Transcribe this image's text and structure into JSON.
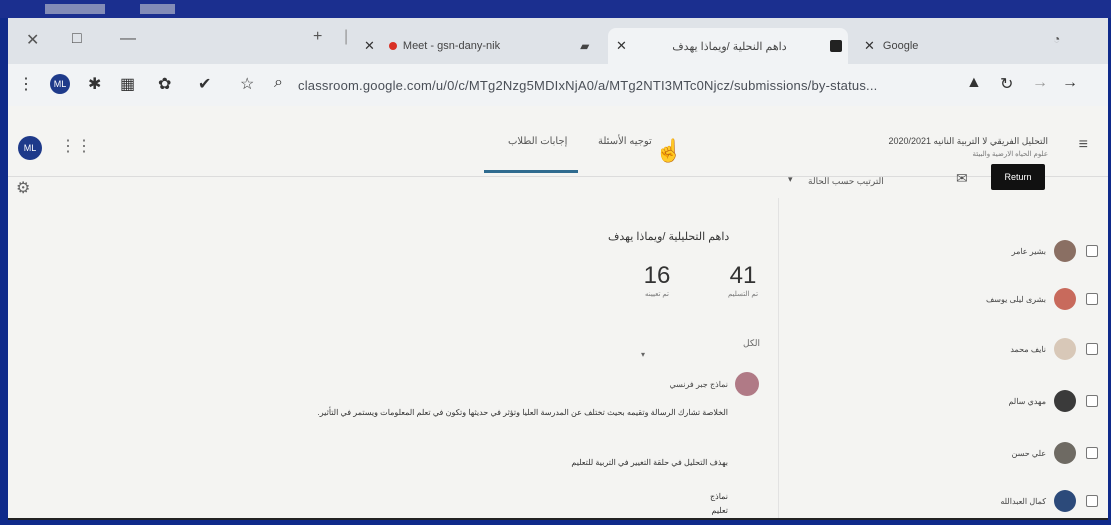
{
  "browser": {
    "tabs": [
      {
        "label": "Meet - gsn-dany-nik"
      },
      {
        "label": "داهم النحلية /ويماذا يهدف"
      },
      {
        "label": "Google"
      }
    ],
    "url": "classroom.google.com/u/0/c/MTg2Nzg5MDIxNjA0/a/MTg2NTI3MTc0Njcz/submissions/by-status..."
  },
  "classroom": {
    "avatar_initials": "ML",
    "course_title": "التحليل الفريقي لا التربية النانيه 2020/2021",
    "course_subtitle": "علوم الحياه الارضية والبيئة",
    "tabs": {
      "student_work": "إجابات الطلاب",
      "instructions": "توجيه الأسئلة"
    },
    "return_label": "Return",
    "sort_label": "الترتيب حسب الحالة",
    "assignment_title": "داهم التحليلية /ويماذا يهدف",
    "stats": [
      {
        "value": "41",
        "label": "تم التسليم"
      },
      {
        "value": "16",
        "label": "تم تعيينه"
      }
    ],
    "section_label": "الكل"
  },
  "post": {
    "author": "نماذج جبر فرنسي",
    "body": "الخلاصة تشارك الرسالة وتقيمه بحيث تختلف عن المدرسة العليا وتؤثر في حديثها وتكون في تعلم المعلومات ويستمر في التأثير.",
    "line": "بهذف التحليل في حلقة التغيير في التربية للتعليم",
    "sign1": "نماذج",
    "sign2": "تعليم"
  },
  "students": [
    {
      "name": "بشير عامر"
    },
    {
      "name": "بشرى ليلى يوسف"
    },
    {
      "name": "نايف محمد"
    },
    {
      "name": "مهدي سالم"
    },
    {
      "name": "علي حسن"
    },
    {
      "name": "كمال العبدالله"
    }
  ],
  "colors": {
    "accent": "#2f6b8f",
    "bezel": "#1b2f8f"
  }
}
